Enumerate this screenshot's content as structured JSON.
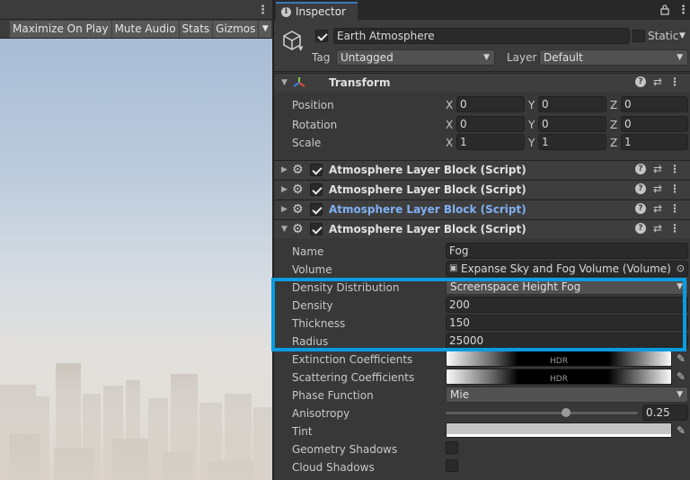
{
  "game_view": {
    "toolbar": {
      "maximize_on_play": "Maximize On Play",
      "mute_audio": "Mute Audio",
      "stats": "Stats",
      "gizmos": "Gizmos"
    }
  },
  "inspector": {
    "tab_label": "Inspector",
    "gameobject": {
      "enabled": true,
      "name": "Earth Atmosphere",
      "static_label": "Static",
      "tag_label": "Tag",
      "tag_value": "Untagged",
      "layer_label": "Layer",
      "layer_value": "Default"
    },
    "transform": {
      "title": "Transform",
      "rows": [
        {
          "label": "Position",
          "x": "0",
          "y": "0",
          "z": "0"
        },
        {
          "label": "Rotation",
          "x": "0",
          "y": "0",
          "z": "0"
        },
        {
          "label": "Scale",
          "x": "1",
          "y": "1",
          "z": "1"
        }
      ],
      "axis_x": "X",
      "axis_y": "Y",
      "axis_z": "Z"
    },
    "components": [
      {
        "title": "Atmosphere Layer Block (Script)",
        "expanded": false,
        "selected": false
      },
      {
        "title": "Atmosphere Layer Block (Script)",
        "expanded": false,
        "selected": false
      },
      {
        "title": "Atmosphere Layer Block (Script)",
        "expanded": false,
        "selected": true
      },
      {
        "title": "Atmosphere Layer Block (Script)",
        "expanded": true,
        "selected": false
      }
    ],
    "layer_block": {
      "name_label": "Name",
      "name_value": "Fog",
      "volume_label": "Volume",
      "volume_value": "Expanse Sky and Fog Volume (Volume)",
      "density_distribution_label": "Density Distribution",
      "density_distribution_value": "Screenspace Height Fog",
      "density_label": "Density",
      "density_value": "200",
      "thickness_label": "Thickness",
      "thickness_value": "150",
      "radius_label": "Radius",
      "radius_value": "25000",
      "extinction_label": "Extinction Coefficients",
      "scattering_label": "Scattering Coefficients",
      "hdr_tag": "HDR",
      "phase_function_label": "Phase Function",
      "phase_function_value": "Mie",
      "anisotropy_label": "Anisotropy",
      "anisotropy_value": "0.25",
      "anisotropy_fraction": 0.625,
      "tint_label": "Tint",
      "geometry_shadows_label": "Geometry Shadows",
      "geometry_shadows": false,
      "cloud_shadows_label": "Cloud Shadows",
      "cloud_shadows": false
    }
  },
  "colors": {
    "highlight": "#0a9be0",
    "selected_title": "#7fb0f3",
    "tab_accent": "#3a79bb"
  },
  "icons": [
    "more-vertical-icon",
    "info-icon",
    "lock-icon",
    "gameobject-cube-icon",
    "transform-axes-icon",
    "script-gear-icon",
    "help-icon",
    "presets-icon",
    "eyedropper-icon",
    "object-picker-icon",
    "volume-icon",
    "foldout-arrow-icon",
    "dropdown-arrow-icon"
  ]
}
